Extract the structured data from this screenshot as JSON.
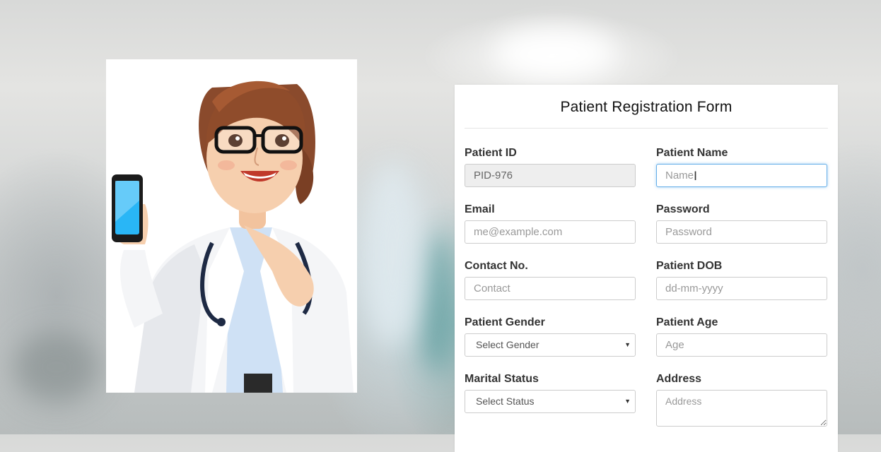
{
  "form": {
    "title": "Patient Registration Form",
    "fields": {
      "patient_id": {
        "label": "Patient ID",
        "value": "PID-976"
      },
      "patient_name": {
        "label": "Patient Name",
        "placeholder": "Name"
      },
      "email": {
        "label": "Email",
        "placeholder": "me@example.com"
      },
      "password": {
        "label": "Password",
        "placeholder": "Password"
      },
      "contact": {
        "label": "Contact No.",
        "placeholder": "Contact"
      },
      "dob": {
        "label": "Patient DOB",
        "placeholder": "dd-mm-yyyy"
      },
      "gender": {
        "label": "Patient Gender",
        "selected": "Select Gender"
      },
      "age": {
        "label": "Patient Age",
        "placeholder": "Age"
      },
      "marital": {
        "label": "Marital Status",
        "selected": "Select Status"
      },
      "address": {
        "label": "Address",
        "placeholder": "Address"
      }
    }
  },
  "illustration": {
    "icon": "doctor-with-phone-illustration"
  },
  "colors": {
    "focus_border": "#66afe9",
    "readonly_bg": "#eeeeee"
  }
}
